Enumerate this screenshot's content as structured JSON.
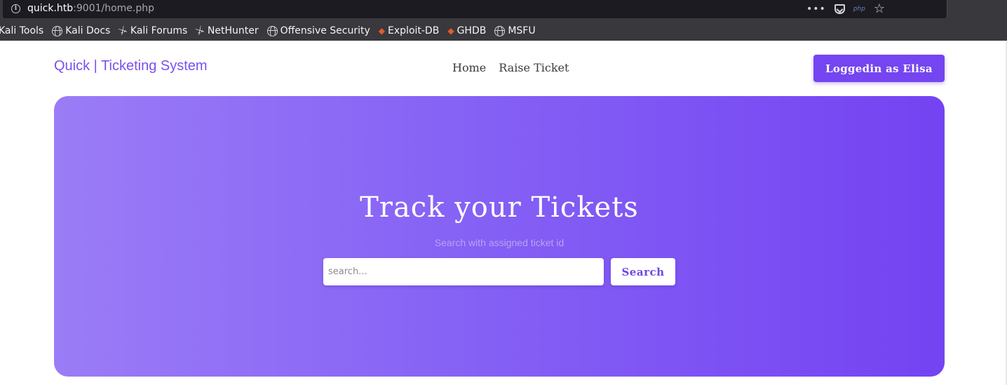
{
  "browser": {
    "url_host": "quick.htb",
    "url_rest": ":9001/home.php",
    "actions": {
      "more_icon": "more-dots-icon",
      "pocket_icon": "pocket-icon",
      "php_badge": "php",
      "bookmark_icon": "star-icon"
    },
    "bookmarks": [
      {
        "label": "Kali Tools",
        "icon": "dragon-icon"
      },
      {
        "label": "Kali Docs",
        "icon": "globe-icon"
      },
      {
        "label": "Kali Forums",
        "icon": "dragon-icon"
      },
      {
        "label": "NetHunter",
        "icon": "dragon-icon"
      },
      {
        "label": "Offensive Security",
        "icon": "globe-icon"
      },
      {
        "label": "Exploit-DB",
        "icon": "exploit-db-icon"
      },
      {
        "label": "GHDB",
        "icon": "exploit-db-icon"
      },
      {
        "label": "MSFU",
        "icon": "globe-icon"
      }
    ]
  },
  "site": {
    "brand": "Quick | Ticketing System",
    "nav": [
      "Home",
      "Raise Ticket"
    ],
    "login_label": "Loggedin as Elisa"
  },
  "hero": {
    "title": "Track your Tickets",
    "subtitle": "Search with assigned ticket id",
    "search_placeholder": "search...",
    "search_button": "Search"
  },
  "colors": {
    "accent": "#7445f0",
    "hero_start": "#9b7cf6",
    "hero_end": "#7443f2"
  }
}
